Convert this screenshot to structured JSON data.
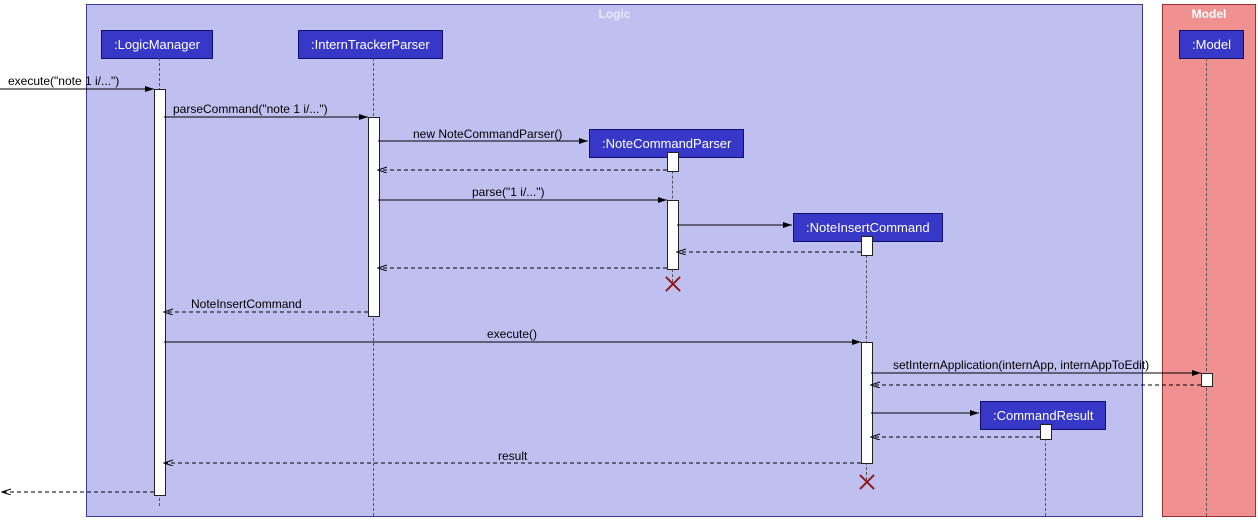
{
  "boxes": {
    "logic": {
      "title": "Logic"
    },
    "model": {
      "title": "Model"
    }
  },
  "participants": {
    "logicManager": ":LogicManager",
    "internTrackerParser": ":InternTrackerParser",
    "noteCommandParser": ":NoteCommandParser",
    "noteInsertCommand": ":NoteInsertCommand",
    "commandResult": ":CommandResult",
    "model": ":Model"
  },
  "messages": {
    "execute1": "execute(\"note 1 i/...\")",
    "parseCommand": "parseCommand(\"note 1 i/...\")",
    "newNoteCommandParser": "new NoteCommandParser()",
    "parse": "parse(\"1 i/...\")",
    "noteInsertCommand": "NoteInsertCommand",
    "execute2": "execute()",
    "setInternApplication": "setInternApplication(internApp, internAppToEdit)",
    "result": "result"
  },
  "chart_data": {
    "type": "uml-sequence",
    "boxes": [
      {
        "name": "Logic",
        "participants": [
          "LogicManager",
          "InternTrackerParser",
          "NoteCommandParser",
          "NoteInsertCommand",
          "CommandResult"
        ]
      },
      {
        "name": "Model",
        "participants": [
          "Model"
        ]
      }
    ],
    "participants": [
      "LogicManager",
      "InternTrackerParser",
      "NoteCommandParser",
      "NoteInsertCommand",
      "CommandResult",
      "Model"
    ],
    "messages": [
      {
        "from": "external",
        "to": "LogicManager",
        "label": "execute(\"note 1 i/...\")",
        "type": "sync"
      },
      {
        "from": "LogicManager",
        "to": "InternTrackerParser",
        "label": "parseCommand(\"note 1 i/...\")",
        "type": "sync"
      },
      {
        "from": "InternTrackerParser",
        "to": "NoteCommandParser",
        "label": "new NoteCommandParser()",
        "type": "create"
      },
      {
        "from": "NoteCommandParser",
        "to": "InternTrackerParser",
        "label": "",
        "type": "return"
      },
      {
        "from": "InternTrackerParser",
        "to": "NoteCommandParser",
        "label": "parse(\"1 i/...\")",
        "type": "sync"
      },
      {
        "from": "NoteCommandParser",
        "to": "NoteInsertCommand",
        "label": "",
        "type": "create"
      },
      {
        "from": "NoteInsertCommand",
        "to": "NoteCommandParser",
        "label": "",
        "type": "return"
      },
      {
        "from": "NoteCommandParser",
        "to": "InternTrackerParser",
        "label": "",
        "type": "return"
      },
      {
        "note": "NoteCommandParser destroyed"
      },
      {
        "from": "InternTrackerParser",
        "to": "LogicManager",
        "label": "NoteInsertCommand",
        "type": "return"
      },
      {
        "from": "LogicManager",
        "to": "NoteInsertCommand",
        "label": "execute()",
        "type": "sync"
      },
      {
        "from": "NoteInsertCommand",
        "to": "Model",
        "label": "setInternApplication(internApp, internAppToEdit)",
        "type": "sync"
      },
      {
        "from": "Model",
        "to": "NoteInsertCommand",
        "label": "",
        "type": "return"
      },
      {
        "from": "NoteInsertCommand",
        "to": "CommandResult",
        "label": "",
        "type": "create"
      },
      {
        "from": "CommandResult",
        "to": "NoteInsertCommand",
        "label": "",
        "type": "return"
      },
      {
        "from": "NoteInsertCommand",
        "to": "LogicManager",
        "label": "result",
        "type": "return"
      },
      {
        "note": "NoteInsertCommand destroyed"
      },
      {
        "from": "LogicManager",
        "to": "external",
        "label": "",
        "type": "return"
      }
    ]
  }
}
